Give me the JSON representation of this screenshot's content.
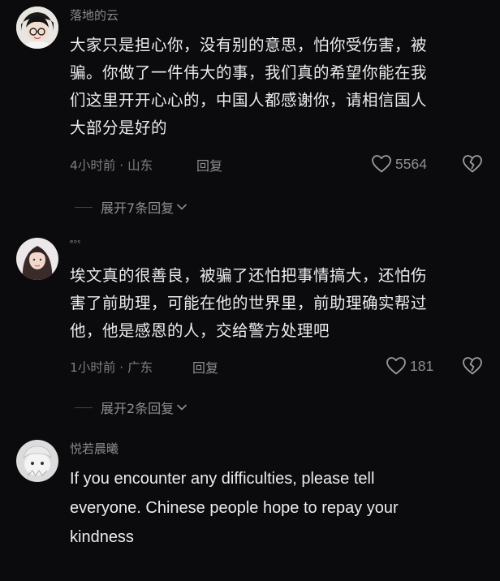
{
  "comments": [
    {
      "username": "落地的云",
      "lines": [
        "大家只是担心你，没有别的意思，怕你受伤害，被",
        "骗。你做了一件伟大的事，我们真的希望你能在我",
        "们这里开开心心的，中国人都感谢你，请相信国人",
        "大部分是好的"
      ],
      "meta": "4小时前 · 山东",
      "reply_label": "回复",
      "likes": "5564",
      "expand_label": "展开7条回复"
    },
    {
      "username": "ᵉᵒˢ",
      "lines": [
        "埃文真的很善良，被骗了还怕把事情搞大，还怕伤",
        "害了前助理，可能在他的世界里，前助理确实帮过",
        "他，他是感恩的人，交给警方处理吧"
      ],
      "meta": "1小时前 · 广东",
      "reply_label": "回复",
      "likes": "181",
      "expand_label": "展开2条回复"
    },
    {
      "username": "悦若晨曦",
      "lines": [
        "If you encounter any difficulties, please tell",
        "everyone. Chinese people hope to repay your",
        "kindness"
      ]
    }
  ],
  "icons": {
    "like": "heart-outline-icon",
    "dislike": "broken-heart-icon",
    "expand": "chevron-down-icon"
  },
  "colors": {
    "background": "#0b0b0d",
    "text": "#ececec",
    "muted": "#8e8e92"
  }
}
